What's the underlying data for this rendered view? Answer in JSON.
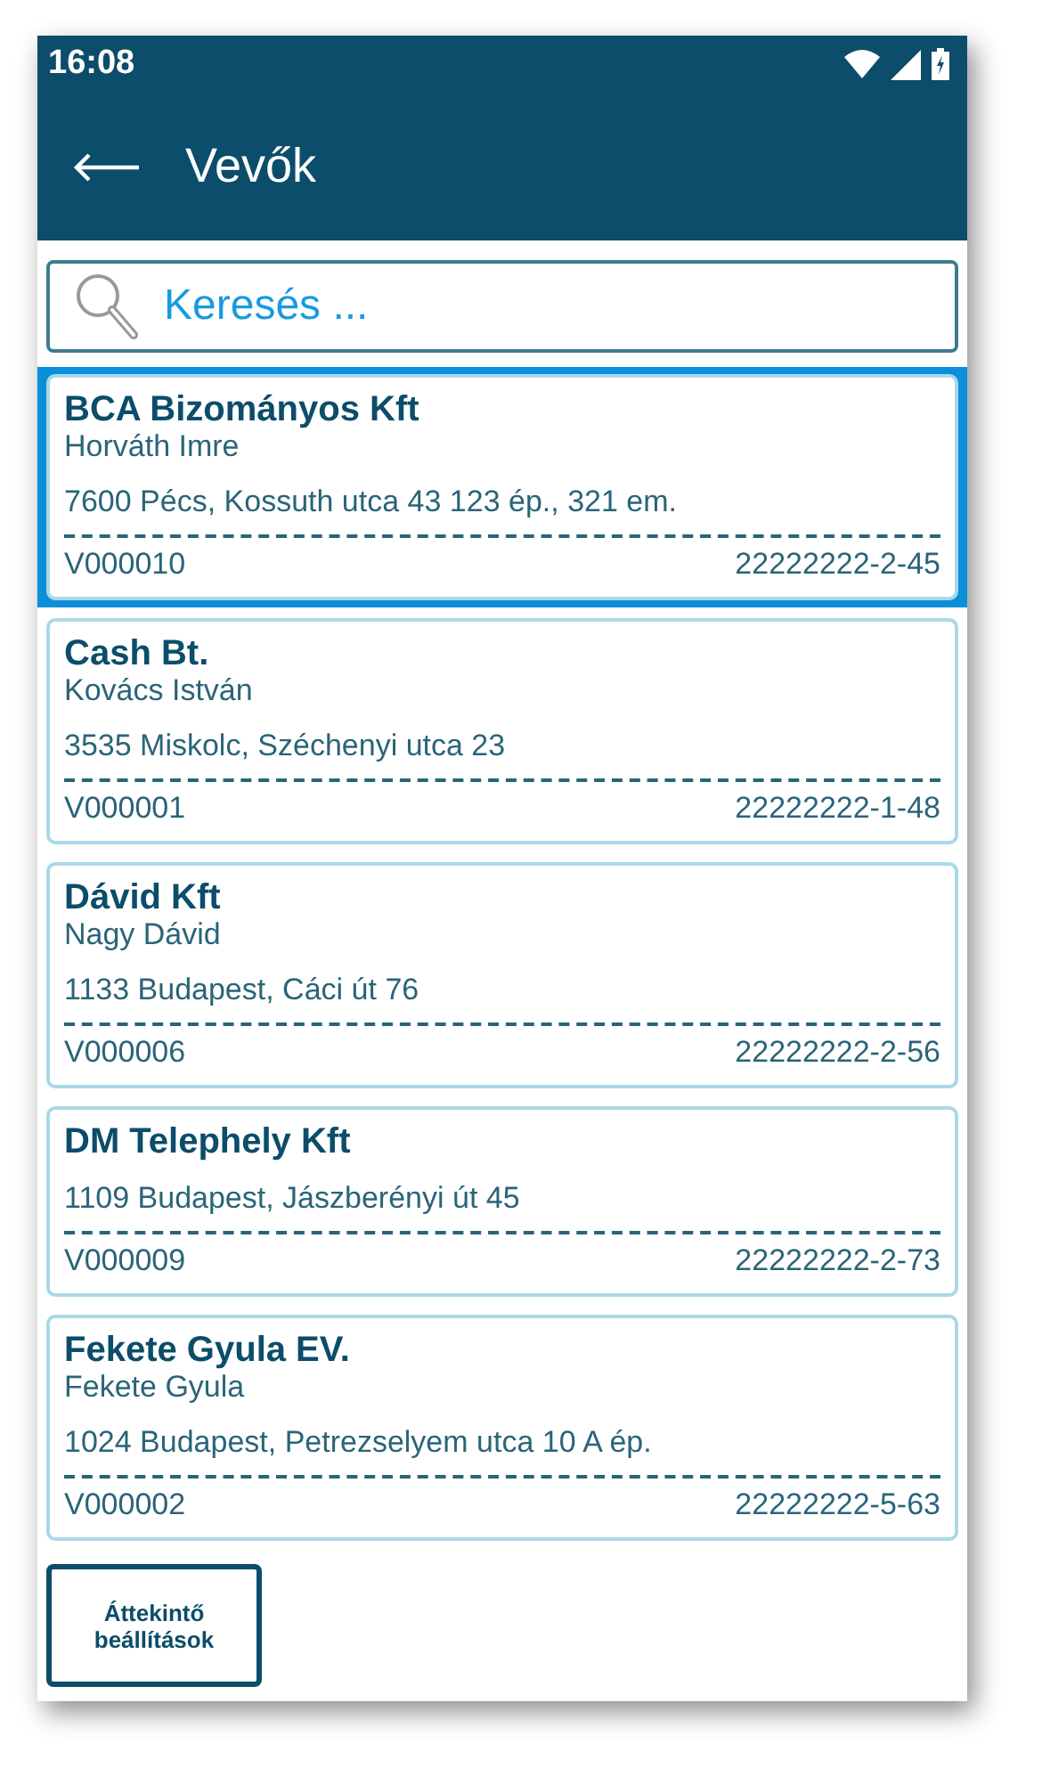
{
  "status_bar": {
    "time": "16:08"
  },
  "app_bar": {
    "title": "Vevők"
  },
  "search": {
    "placeholder": "Keresés ..."
  },
  "customers": [
    {
      "name": "BCA Bizományos Kft",
      "contact": "Horváth Imre",
      "address": "7600 Pécs, Kossuth utca 43 123 ép., 321 em.",
      "code": "V000010",
      "tax_number": "22222222-2-45",
      "selected": true
    },
    {
      "name": "Cash Bt.",
      "contact": "Kovács István",
      "address": "3535 Miskolc, Széchenyi utca 23",
      "code": "V000001",
      "tax_number": "22222222-1-48",
      "selected": false
    },
    {
      "name": "Dávid Kft",
      "contact": "Nagy Dávid",
      "address": "1133 Budapest, Cáci út 76",
      "code": "V000006",
      "tax_number": "22222222-2-56",
      "selected": false
    },
    {
      "name": "DM Telephely Kft",
      "address": "1109 Budapest, Jászberényi út 45",
      "code": "V000009",
      "tax_number": "22222222-2-73",
      "selected": false
    },
    {
      "name": "Fekete Gyula EV.",
      "contact": "Fekete Gyula",
      "address": "1024 Budapest, Petrezselyem utca 10 A ép.",
      "code": "V000002",
      "tax_number": "22222222-5-63",
      "selected": false
    }
  ],
  "overview_button": {
    "label": "Áttekintő beállítások"
  }
}
